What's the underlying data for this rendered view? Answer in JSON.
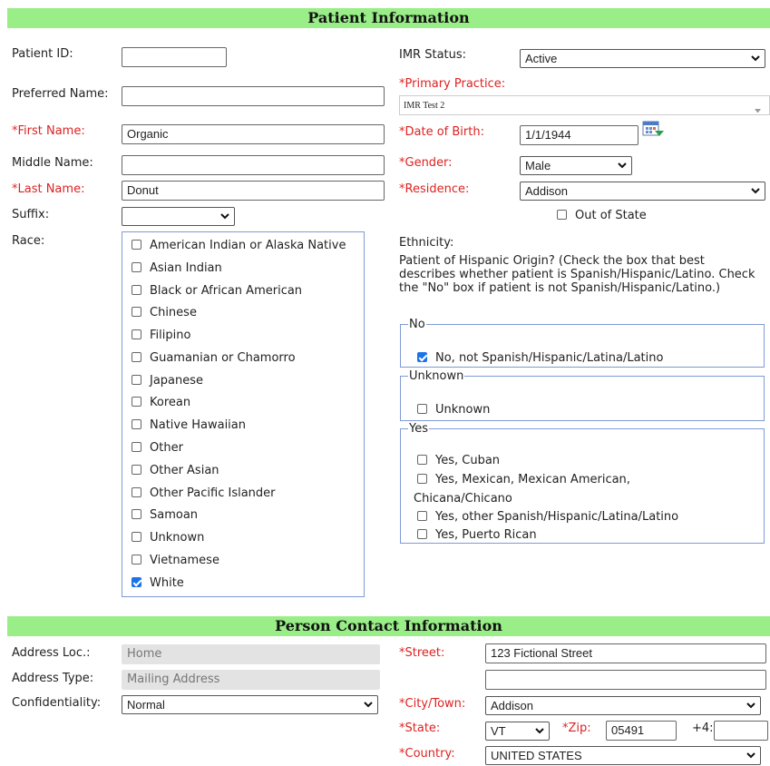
{
  "patient_section": {
    "title": "Patient Information",
    "patient_id": {
      "label": "Patient ID:",
      "value": ""
    },
    "preferred_name": {
      "label": "Preferred Name:",
      "value": ""
    },
    "first_name": {
      "label": "*First Name:",
      "value": "Organic"
    },
    "middle_name": {
      "label": "Middle Name:",
      "value": ""
    },
    "last_name": {
      "label": "*Last Name:",
      "value": "Donut"
    },
    "suffix": {
      "label": "Suffix:",
      "value": ""
    },
    "race": {
      "label": "Race:",
      "options": [
        {
          "label": "American Indian or Alaska Native",
          "checked": false
        },
        {
          "label": "Asian Indian",
          "checked": false
        },
        {
          "label": "Black or African American",
          "checked": false
        },
        {
          "label": "Chinese",
          "checked": false
        },
        {
          "label": "Filipino",
          "checked": false
        },
        {
          "label": "Guamanian or Chamorro",
          "checked": false
        },
        {
          "label": "Japanese",
          "checked": false
        },
        {
          "label": "Korean",
          "checked": false
        },
        {
          "label": "Native Hawaiian",
          "checked": false
        },
        {
          "label": "Other",
          "checked": false
        },
        {
          "label": "Other Asian",
          "checked": false
        },
        {
          "label": "Other Pacific Islander",
          "checked": false
        },
        {
          "label": "Samoan",
          "checked": false
        },
        {
          "label": "Unknown",
          "checked": false
        },
        {
          "label": "Vietnamese",
          "checked": false
        },
        {
          "label": "White",
          "checked": true
        }
      ]
    },
    "imr_status": {
      "label": "IMR Status:",
      "value": "Active"
    },
    "primary_practice": {
      "label": "*Primary Practice:",
      "value": "IMR Test 2"
    },
    "date_of_birth": {
      "label": "*Date of Birth:",
      "value": "1/1/1944",
      "icon": "calendar-icon"
    },
    "gender": {
      "label": "*Gender:",
      "value": "Male"
    },
    "residence": {
      "label": "*Residence:",
      "value": "Addison"
    },
    "out_of_state": {
      "label": "Out of State",
      "checked": false
    },
    "ethnicity": {
      "label": "Ethnicity:",
      "description": "Patient of Hispanic Origin? (Check the box that best describes whether patient is Spanish/Hispanic/Latino. Check the \"No\" box if patient is not Spanish/Hispanic/Latino.)",
      "groups": {
        "no": {
          "legend": "No",
          "options": [
            {
              "label": "No, not Spanish/Hispanic/Latina/Latino",
              "checked": true
            }
          ]
        },
        "unknown": {
          "legend": "Unknown",
          "options": [
            {
              "label": "Unknown",
              "checked": false
            }
          ]
        },
        "yes": {
          "legend": "Yes",
          "options": [
            {
              "label": "Yes, Cuban",
              "checked": false
            },
            {
              "label": "Yes, Mexican, Mexican American,",
              "continuation": "Chicana/Chicano",
              "checked": false
            },
            {
              "label": "Yes, other Spanish/Hispanic/Latina/Latino",
              "checked": false
            },
            {
              "label": "Yes, Puerto Rican",
              "checked": false
            }
          ]
        }
      }
    }
  },
  "contact_section": {
    "title": "Person Contact Information",
    "address_loc": {
      "label": "Address Loc.:",
      "value": "Home"
    },
    "address_type": {
      "label": "Address Type:",
      "value": "Mailing Address"
    },
    "confidentiality": {
      "label": "Confidentiality:",
      "value": "Normal"
    },
    "street": {
      "label": "*Street:",
      "value": "123 Fictional Street",
      "value2": ""
    },
    "city": {
      "label": "*City/Town:",
      "value": "Addison"
    },
    "state": {
      "label": "*State:",
      "value": "VT"
    },
    "zip": {
      "label": "*Zip:",
      "value": "05491",
      "plus4_label": "+4:",
      "plus4_value": ""
    },
    "country": {
      "label": "*Country:",
      "value": "UNITED STATES"
    }
  },
  "colors": {
    "header_bg": "#99ee88",
    "required": "#dd2222",
    "group_border": "#7d9bd6",
    "checkbox_on": "#1a73e8"
  }
}
